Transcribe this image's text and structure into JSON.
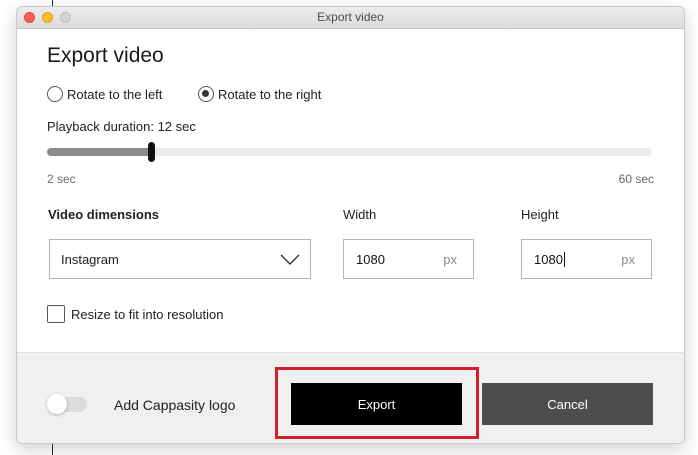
{
  "window": {
    "title": "Export video",
    "heading": "Export video"
  },
  "rotation": {
    "options": [
      {
        "label": "Rotate to the left",
        "checked": false
      },
      {
        "label": "Rotate to the right",
        "checked": true
      }
    ]
  },
  "duration": {
    "label": "Playback duration: 12 sec",
    "value": 12,
    "min": 2,
    "max": 60,
    "min_label": "2 sec",
    "max_label": "60 sec"
  },
  "dimensions": {
    "heading": "Video dimensions",
    "preset": "Instagram",
    "width_label": "Width",
    "width_value": "1080",
    "height_label": "Height",
    "height_value": "1080",
    "unit": "px"
  },
  "resize": {
    "label": "Resize to fit into resolution",
    "checked": false
  },
  "footer": {
    "logo_label": "Add Cappasity logo",
    "logo_enabled": false,
    "export_label": "Export",
    "cancel_label": "Cancel"
  },
  "colors": {
    "highlight": "#d1202c",
    "export_bg": "#000000",
    "cancel_bg": "#4d4d4d"
  },
  "icons": [
    "chevron-down-icon"
  ]
}
